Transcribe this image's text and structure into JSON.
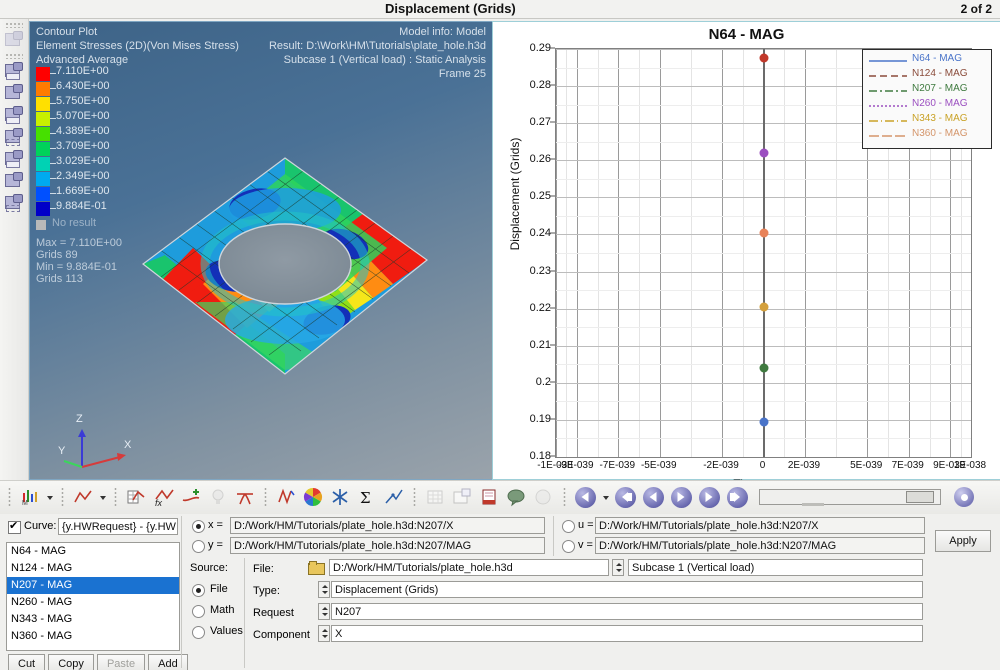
{
  "titlebar": {
    "title": "Displacement (Grids)",
    "count": "2 of 2"
  },
  "graphics": {
    "header_left": [
      "Contour Plot",
      "Element Stresses (2D)(Von Mises Stress)",
      "Advanced Average"
    ],
    "header_right": [
      "Model info: Model",
      "Result: D:\\Work\\HM\\Tutorials\\plate_hole.h3d",
      "Subcase 1 (Vertical load) : Static Analysis",
      "Frame 25"
    ],
    "legend": [
      {
        "value": "7.110E+00",
        "color": "#ff0000"
      },
      {
        "value": "6.430E+00",
        "color": "#ff7b00"
      },
      {
        "value": "5.750E+00",
        "color": "#ffe000"
      },
      {
        "value": "5.070E+00",
        "color": "#c8f000"
      },
      {
        "value": "4.389E+00",
        "color": "#46e000"
      },
      {
        "value": "3.709E+00",
        "color": "#00d25a"
      },
      {
        "value": "3.029E+00",
        "color": "#00d2b4"
      },
      {
        "value": "2.349E+00",
        "color": "#00aaf0"
      },
      {
        "value": "1.669E+00",
        "color": "#0050ff"
      },
      {
        "value": "9.884E-01",
        "color": "#0000c8"
      }
    ],
    "no_result_label": "No result",
    "stats": [
      "Max = 7.110E+00",
      "Grids 89",
      "Min = 9.884E-01",
      "Grids 113"
    ],
    "triad": {
      "x": "X",
      "y": "Y",
      "z": "Z"
    }
  },
  "chart_data": {
    "type": "scatter",
    "title": "N64 - MAG",
    "xlabel": "Time",
    "ylabel": "Displacement (Grids)",
    "xlim": [
      -1e-38,
      1e-38
    ],
    "ylim": [
      0.18,
      0.29
    ],
    "grid": true,
    "legend_position": "top-right",
    "xticks": [
      "-1E-038",
      "-9E-039",
      "-7E-039",
      "-5E-039",
      "-2E-039",
      "0",
      "2E-039",
      "5E-039",
      "7E-039",
      "9E-039",
      "1E-038"
    ],
    "xtick_values": [
      -1e-38,
      -9e-39,
      -7e-39,
      -5e-39,
      -2e-39,
      0,
      2e-39,
      5e-39,
      7e-39,
      9e-39,
      1e-38
    ],
    "yticks": [
      "0.18",
      "0.19",
      "0.2",
      "0.21",
      "0.22",
      "0.23",
      "0.24",
      "0.25",
      "0.26",
      "0.27",
      "0.28",
      "0.29"
    ],
    "ytick_values": [
      0.18,
      0.19,
      0.2,
      0.21,
      0.22,
      0.23,
      0.24,
      0.25,
      0.26,
      0.27,
      0.28,
      0.29
    ],
    "series": [
      {
        "name": "N64 - MAG",
        "color": "#4a74c9",
        "dash": "solid",
        "x": [
          0
        ],
        "y": [
          0.1895
        ]
      },
      {
        "name": "N124 - MAG",
        "color": "#8a4b3a",
        "dash": "dashed",
        "x": [
          0
        ],
        "y": [
          0.204
        ]
      },
      {
        "name": "N207 - MAG",
        "color": "#3f7a3f",
        "dash": "dashdot",
        "x": [
          0
        ],
        "y": [
          0.2205
        ]
      },
      {
        "name": "N260 - MAG",
        "color": "#9b4fc0",
        "dash": "dotted",
        "x": [
          0
        ],
        "y": [
          0.2405
        ]
      },
      {
        "name": "N343 - MAG",
        "color": "#c9a227",
        "dash": "dashdot2",
        "x": [
          0
        ],
        "y": [
          0.262
        ]
      },
      {
        "name": "N360 - MAG",
        "color": "#d4956a",
        "dash": "dashed2",
        "x": [
          0
        ],
        "y": [
          0.2875
        ]
      }
    ],
    "marker_colors": [
      "#4a74c9",
      "#3f7a3f",
      "#d4a03c",
      "#e8835a",
      "#9b4fc0",
      "#c1392b"
    ],
    "marker_values": [
      0.1895,
      0.204,
      0.2205,
      0.2405,
      0.262,
      0.2875
    ],
    "marker_x": 0
  },
  "toolbar": {
    "icons": [
      "plot-browser-icon",
      "chevron-down-icon",
      "curve-plot-icon",
      "chevron-down-icon-2",
      "build-plot-icon",
      "curve-math-icon",
      "curve-edit-icon",
      "bulb-icon",
      "crosshair-icon",
      "vector-icon",
      "color-wheel-icon",
      "asterisk-icon",
      "sigma-icon",
      "curve-fit-icon",
      "grid-icon",
      "annotate-grid-icon",
      "note-icon",
      "bubble-icon",
      "sphere-icon"
    ],
    "nav": [
      "previous-page-button",
      "step-back-button",
      "rewind-button",
      "play-button",
      "fast-forward-button",
      "skip-end-button"
    ],
    "slider_name": "animation-slider",
    "gear_name": "animation-settings-button"
  },
  "bottom": {
    "curve_checkbox_label": "Curve:",
    "curve_checked": true,
    "curve_name_value": "{y.HWRequest} - {y.HW",
    "curve_list": [
      "N64 - MAG",
      "N124 - MAG",
      "N207 - MAG",
      "N260 - MAG",
      "N343 - MAG",
      "N360 - MAG"
    ],
    "curve_list_selected_index": 2,
    "buttons": {
      "cut": "Cut",
      "copy": "Copy",
      "paste": "Paste",
      "paste_disabled": true,
      "add": "Add",
      "apply": "Apply"
    },
    "axis_fields": [
      {
        "id": "x",
        "label": "x =",
        "selected": true,
        "value": "D:/Work/HM/Tutorials/plate_hole.h3d:N207/X"
      },
      {
        "id": "y",
        "label": "y =",
        "selected": false,
        "value": "D:/Work/HM/Tutorials/plate_hole.h3d:N207/MAG"
      },
      {
        "id": "u",
        "label": "u =",
        "selected": false,
        "value": "D:/Work/HM/Tutorials/plate_hole.h3d:N207/X"
      },
      {
        "id": "v",
        "label": "v =",
        "selected": false,
        "value": "D:/Work/HM/Tutorials/plate_hole.h3d:N207/MAG"
      }
    ],
    "source": {
      "label": "Source:",
      "options": [
        {
          "label": "File",
          "selected": true
        },
        {
          "label": "Math",
          "selected": false
        },
        {
          "label": "Values",
          "selected": false
        }
      ]
    },
    "fields": [
      {
        "label": "File:",
        "value": "D:/Work/HM/Tutorials/plate_hole.h3d",
        "right": "Subcase 1 (Vertical load)"
      },
      {
        "label": "Type:",
        "value": "Displacement (Grids)",
        "right": ""
      },
      {
        "label": "Request",
        "value": "N207",
        "right": ""
      },
      {
        "label": "Component",
        "value": "X",
        "right": ""
      }
    ]
  }
}
